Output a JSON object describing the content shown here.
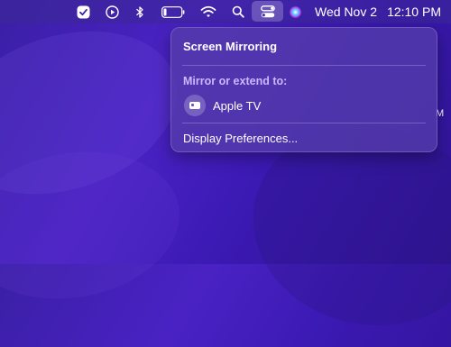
{
  "menubar": {
    "date": "Wed Nov 2",
    "time": "12:10 PM"
  },
  "popover": {
    "title": "Screen Mirroring",
    "section_label": "Mirror or extend to:",
    "devices": [
      {
        "name": "Apple TV",
        "icon": "apple-tv-icon"
      }
    ],
    "footer_link": "Display Preferences..."
  },
  "desktop": {
    "edge_text": "M"
  }
}
